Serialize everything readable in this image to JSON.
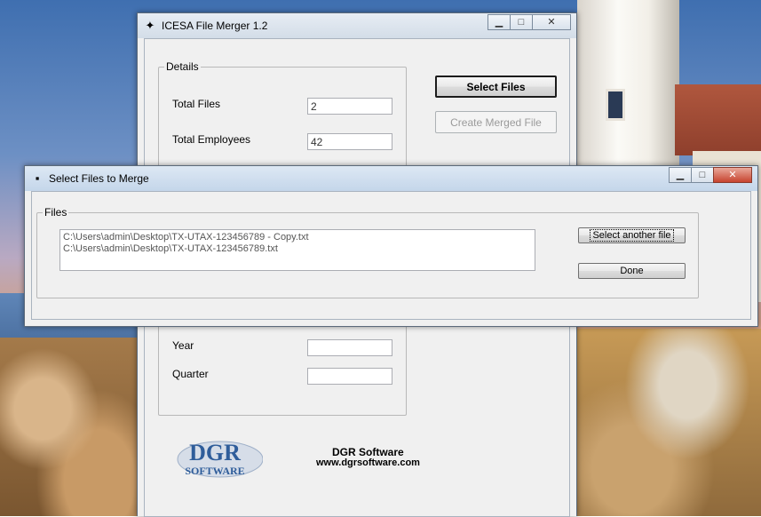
{
  "main_window": {
    "title": "ICESA File Merger  1.2",
    "caption_buttons": {
      "minimize": "▁",
      "maximize": "□",
      "close": "✕"
    },
    "details": {
      "legend": "Details",
      "total_files_label": "Total Files",
      "total_files_value": "2",
      "total_employees_label": "Total Employees",
      "total_employees_value": "42",
      "year_label": "Year",
      "year_value": "",
      "quarter_label": "Quarter",
      "quarter_value": ""
    },
    "select_files_button": "Select Files",
    "create_merged_file_button": "Create Merged File",
    "footer": {
      "logo_top": "DGR",
      "logo_bottom": "SOFTWARE",
      "company": "DGR Software",
      "website": "www.dgrsoftware.com"
    }
  },
  "dialog": {
    "title": "Select Files to Merge",
    "caption_buttons": {
      "minimize": "▁",
      "maximize": "□",
      "close": "✕"
    },
    "files_legend": "Files",
    "files": [
      "C:\\Users\\admin\\Desktop\\TX-UTAX-123456789 - Copy.txt",
      "C:\\Users\\admin\\Desktop\\TX-UTAX-123456789.txt"
    ],
    "select_another_button": "Select another file",
    "done_button": "Done"
  },
  "colors": {
    "titlebar": "#c4d6ea",
    "close_button": "#c7432e",
    "logo_blue": "#2f5d9a"
  }
}
